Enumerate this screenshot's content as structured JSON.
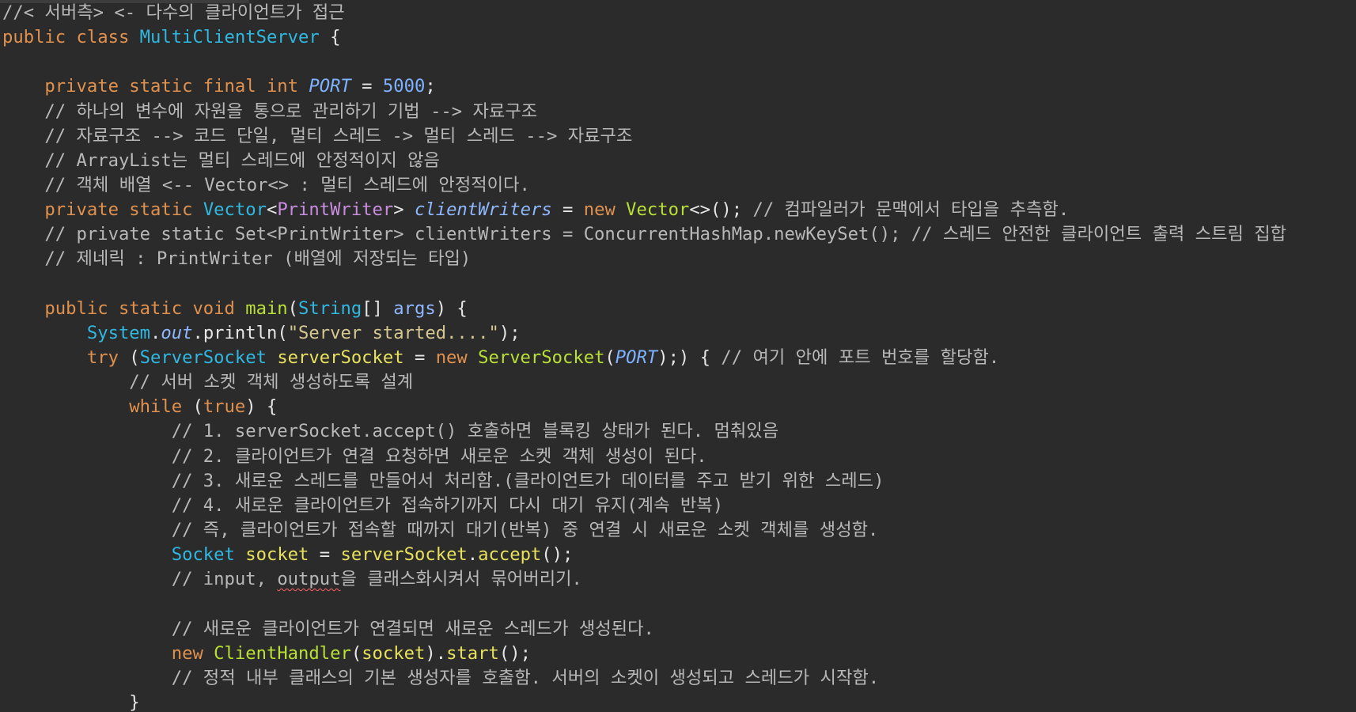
{
  "editor": {
    "background": "#2b2b2b",
    "lines": [
      [
        {
          "t": "//< 서버측> <- 다수의 클라이언트가 접근",
          "c": "comment"
        }
      ],
      [
        {
          "t": "public class ",
          "c": "keyword"
        },
        {
          "t": "MultiClientServer",
          "c": "type"
        },
        {
          "t": " {",
          "c": "default"
        }
      ],
      [],
      [
        {
          "t": "    private static final int ",
          "c": "keyword"
        },
        {
          "t": "PORT",
          "c": "constant"
        },
        {
          "t": " = ",
          "c": "default"
        },
        {
          "t": "5000",
          "c": "number"
        },
        {
          "t": ";",
          "c": "default"
        }
      ],
      [
        {
          "t": "    // 하나의 변수에 자원을 통으로 관리하기 기법 --> 자료구조",
          "c": "comment"
        }
      ],
      [
        {
          "t": "    // 자료구조 --> 코드 단일, 멀티 스레드 -> 멀티 스레드 --> 자료구조",
          "c": "comment"
        }
      ],
      [
        {
          "t": "    // ArrayList는 멀티 스레드에 안정적이지 않음",
          "c": "comment"
        }
      ],
      [
        {
          "t": "    // 객체 배열 <-- Vector<> : 멀티 스레드에 안정적이다.",
          "c": "comment"
        }
      ],
      [
        {
          "t": "    private static ",
          "c": "keyword"
        },
        {
          "t": "Vector",
          "c": "type"
        },
        {
          "t": "<",
          "c": "default"
        },
        {
          "t": "PrintWriter",
          "c": "generic"
        },
        {
          "t": "> ",
          "c": "default"
        },
        {
          "t": "clientWriters",
          "c": "field"
        },
        {
          "t": " = ",
          "c": "default"
        },
        {
          "t": "new ",
          "c": "keyword"
        },
        {
          "t": "Vector",
          "c": "class-green"
        },
        {
          "t": "<>(); ",
          "c": "default"
        },
        {
          "t": "// 컴파일러가 문맥에서 타입을 추측함.",
          "c": "comment"
        }
      ],
      [
        {
          "t": "    // private static Set<PrintWriter> clientWriters = ConcurrentHashMap.newKeySet(); // 스레드 안전한 클라이언트 출력 스트림 집합",
          "c": "comment"
        }
      ],
      [
        {
          "t": "    // 제네릭 : PrintWriter (배열에 저장되는 타입)",
          "c": "comment"
        }
      ],
      [],
      [
        {
          "t": "    public static void ",
          "c": "keyword"
        },
        {
          "t": "main",
          "c": "class-green"
        },
        {
          "t": "(",
          "c": "default"
        },
        {
          "t": "String",
          "c": "type"
        },
        {
          "t": "[] ",
          "c": "default"
        },
        {
          "t": "args",
          "c": "param"
        },
        {
          "t": ") {",
          "c": "default"
        }
      ],
      [
        {
          "t": "        ",
          "c": "default"
        },
        {
          "t": "System",
          "c": "type"
        },
        {
          "t": ".",
          "c": "default"
        },
        {
          "t": "out",
          "c": "field"
        },
        {
          "t": ".println(",
          "c": "default"
        },
        {
          "t": "\"Server started....\"",
          "c": "string"
        },
        {
          "t": ");",
          "c": "default"
        }
      ],
      [
        {
          "t": "        try ",
          "c": "keyword"
        },
        {
          "t": "(",
          "c": "default"
        },
        {
          "t": "ServerSocket",
          "c": "type"
        },
        {
          "t": " ",
          "c": "default"
        },
        {
          "t": "serverSocket",
          "c": "local"
        },
        {
          "t": " = ",
          "c": "default"
        },
        {
          "t": "new ",
          "c": "keyword"
        },
        {
          "t": "ServerSocket",
          "c": "class-green"
        },
        {
          "t": "(",
          "c": "default"
        },
        {
          "t": "PORT",
          "c": "constant"
        },
        {
          "t": ");) { ",
          "c": "default"
        },
        {
          "t": "// 여기 안에 포트 번호를 할당함.",
          "c": "comment"
        }
      ],
      [
        {
          "t": "            // 서버 소켓 객체 생성하도록 설계",
          "c": "comment"
        }
      ],
      [
        {
          "t": "            while ",
          "c": "keyword"
        },
        {
          "t": "(",
          "c": "default"
        },
        {
          "t": "true",
          "c": "keyword"
        },
        {
          "t": ") {",
          "c": "default"
        }
      ],
      [
        {
          "t": "                // 1. serverSocket.accept() 호출하면 블록킹 상태가 된다. 멈춰있음",
          "c": "comment"
        }
      ],
      [
        {
          "t": "                // 2. 클라이언트가 연결 요청하면 새로운 소켓 객체 생성이 된다.",
          "c": "comment"
        }
      ],
      [
        {
          "t": "                // 3. 새로운 스레드를 만들어서 처리함.(클라이언트가 데이터를 주고 받기 위한 스레드)",
          "c": "comment"
        }
      ],
      [
        {
          "t": "                // 4. 새로운 클라이언트가 접속하기까지 다시 대기 유지(계속 반복)",
          "c": "comment"
        }
      ],
      [
        {
          "t": "                // 즉, 클라이언트가 접속할 때까지 대기(반복) 중 연결 시 새로운 소켓 객체를 생성함.",
          "c": "comment"
        }
      ],
      [
        {
          "t": "                ",
          "c": "default"
        },
        {
          "t": "Socket",
          "c": "type"
        },
        {
          "t": " ",
          "c": "default"
        },
        {
          "t": "socket",
          "c": "local"
        },
        {
          "t": " = ",
          "c": "default"
        },
        {
          "t": "serverSocket",
          "c": "local"
        },
        {
          "t": ".",
          "c": "default"
        },
        {
          "t": "accept",
          "c": "local"
        },
        {
          "t": "();",
          "c": "default"
        }
      ],
      [
        {
          "t": "                // input, ",
          "c": "comment"
        },
        {
          "t": "output",
          "c": "comment",
          "u": true
        },
        {
          "t": "을 클래스화시켜서 묶어버리기.",
          "c": "comment"
        }
      ],
      [],
      [
        {
          "t": "                // 새로운 클라이언트가 연결되면 새로운 스레드가 생성된다.",
          "c": "comment"
        }
      ],
      [
        {
          "t": "                new ",
          "c": "keyword"
        },
        {
          "t": "ClientHandler",
          "c": "class-green"
        },
        {
          "t": "(",
          "c": "default"
        },
        {
          "t": "socket",
          "c": "local"
        },
        {
          "t": ").",
          "c": "default"
        },
        {
          "t": "start",
          "c": "local"
        },
        {
          "t": "();",
          "c": "default"
        }
      ],
      [
        {
          "t": "                // 정적 내부 클래스의 기본 생성자를 호출함. 서버의 소켓이 생성되고 스레드가 시작함.",
          "c": "comment"
        }
      ],
      [
        {
          "t": "            }",
          "c": "default"
        }
      ]
    ]
  }
}
